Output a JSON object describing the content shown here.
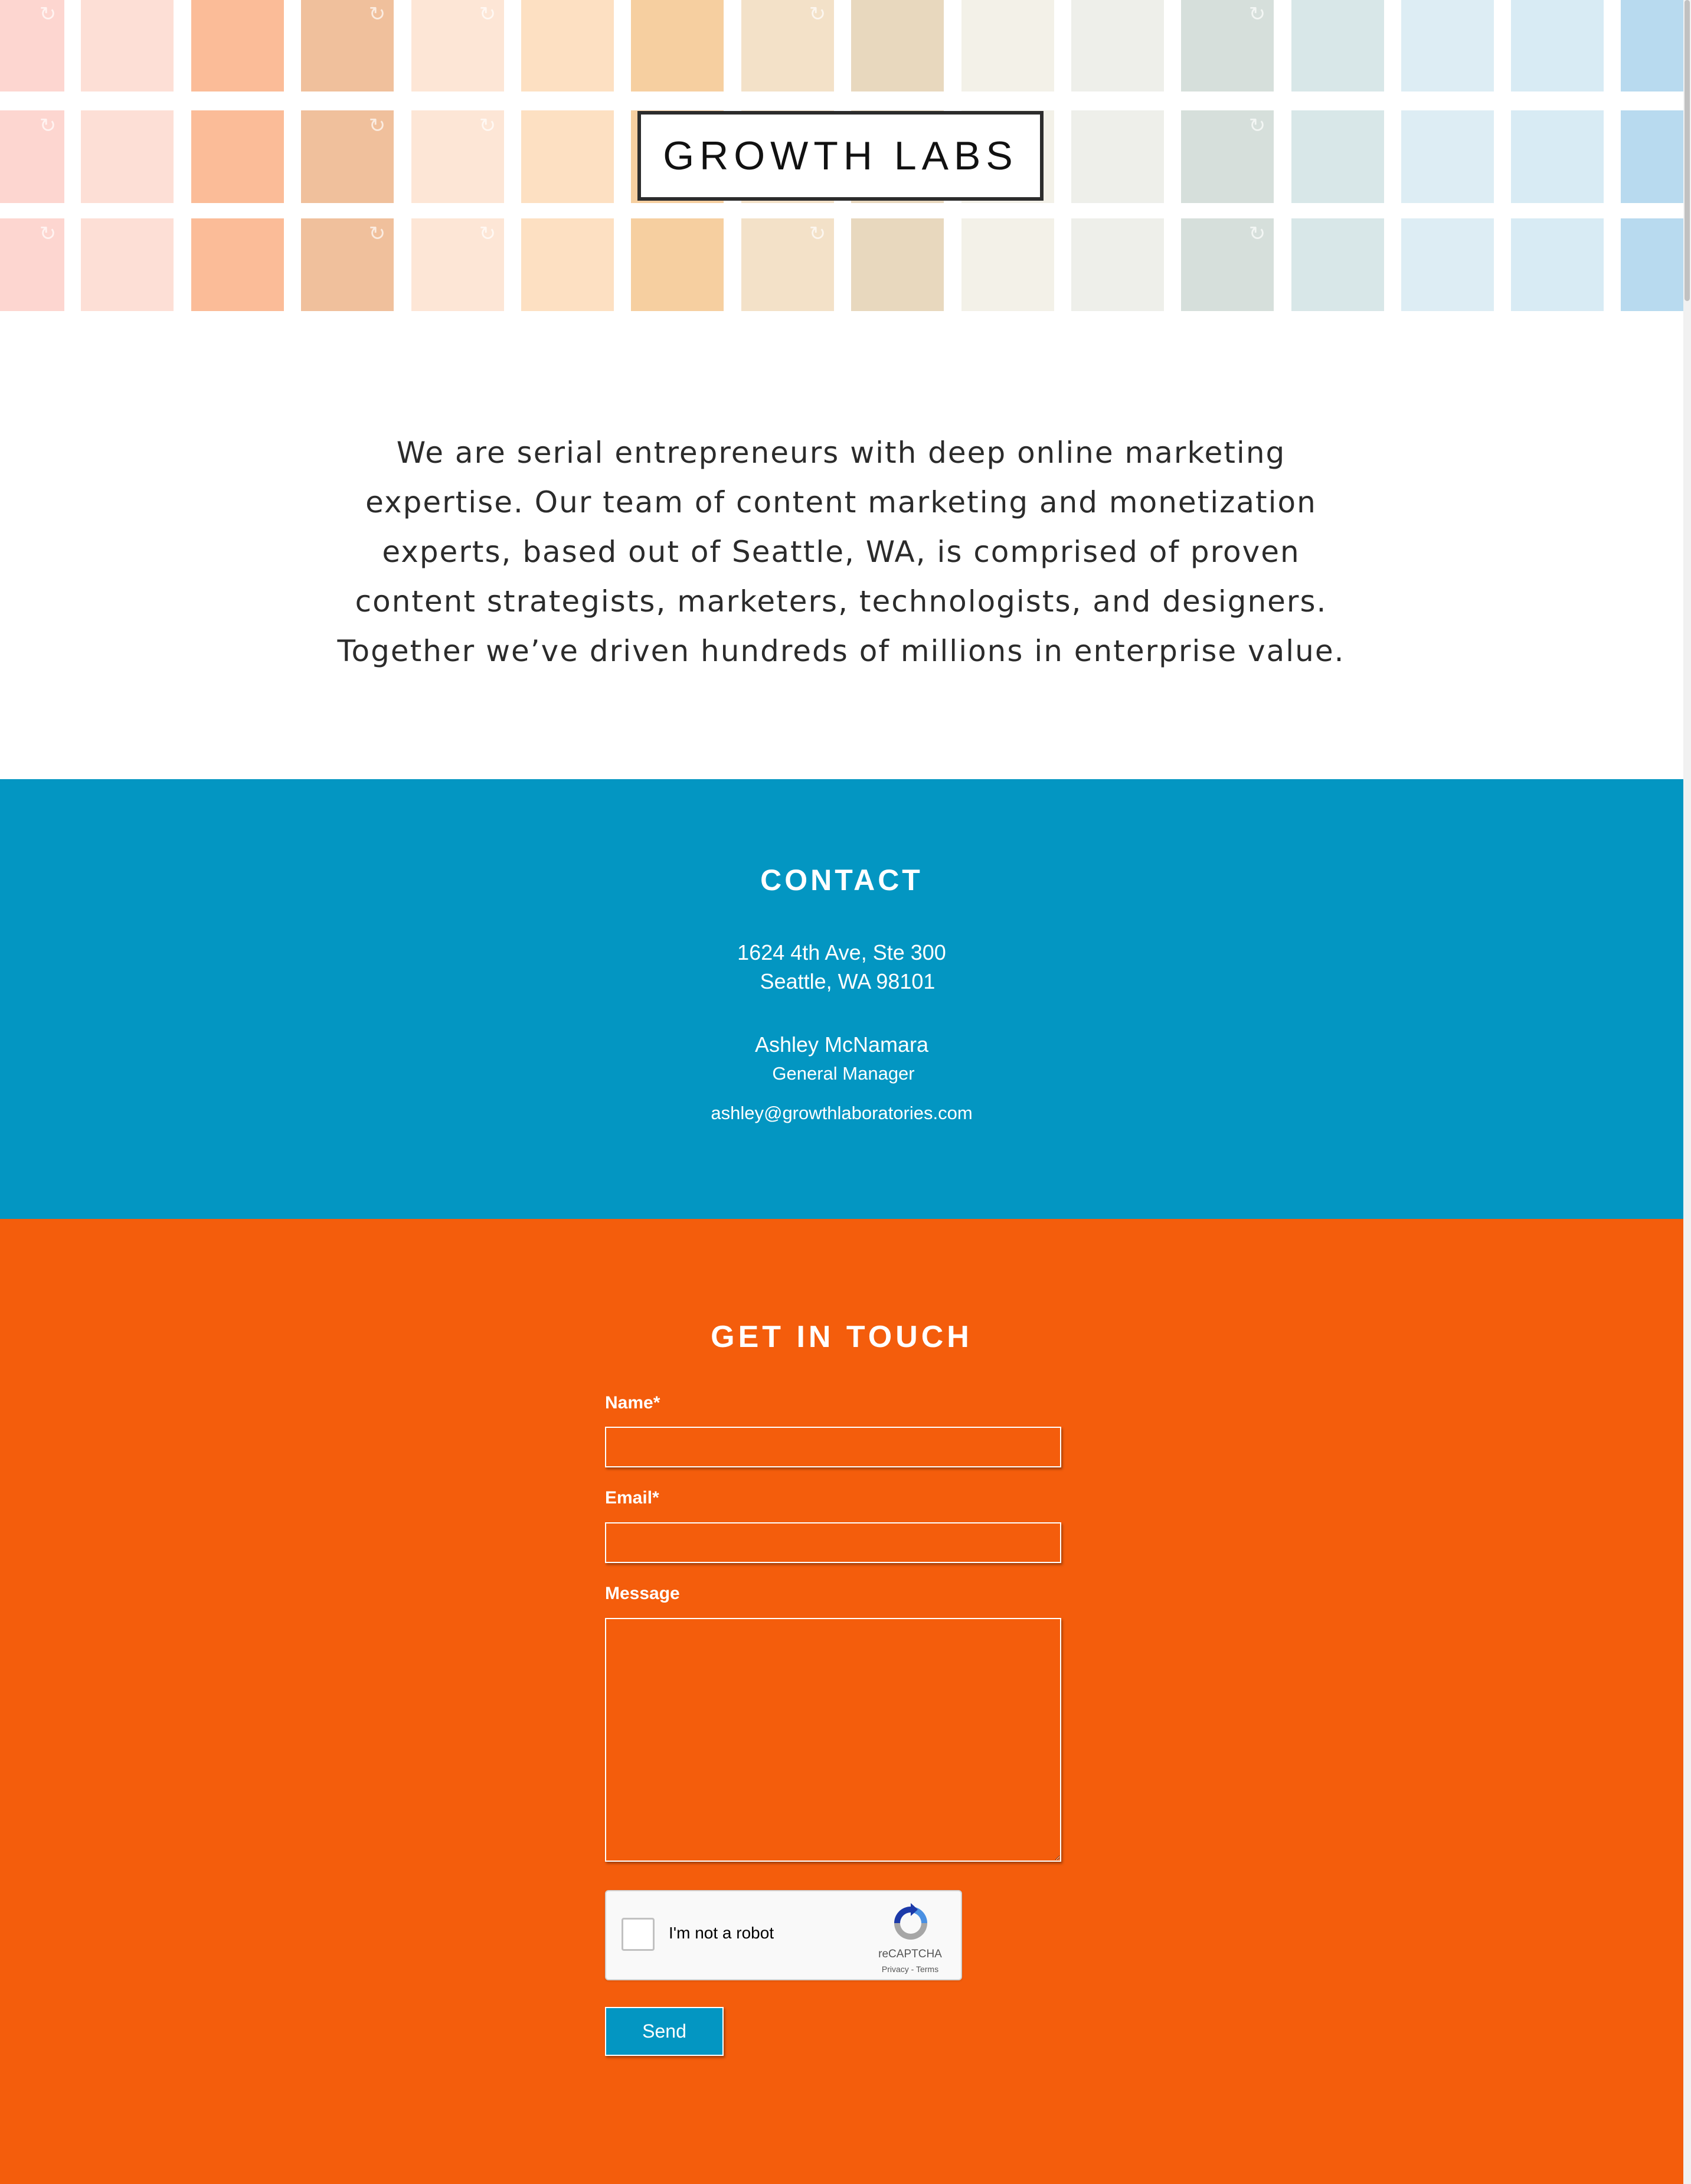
{
  "banner": {
    "logo_text": "GROWTH LABS",
    "tile_colors": [
      "#fdd6d0",
      "#fddfd6",
      "#fbbc98",
      "#f0c09c",
      "#fde6d6",
      "#fde0c2",
      "#f6cfa0",
      "#f3e1c8",
      "#e8d8be",
      "#f3f1e8",
      "#eeefea",
      "#d6dfdb",
      "#d8e7e8",
      "#ddedf4",
      "#d8ebf4",
      "#b8daef"
    ]
  },
  "about": {
    "text": "We are serial entrepreneurs with deep online marketing expertise. Our team of content marketing and monetization experts, based out of Seattle, WA, is comprised of proven content strategists, marketers, technologists, and designers. Together we’ve driven hundreds of millions in enterprise value."
  },
  "contact": {
    "title": "CONTACT",
    "address_line1": "1624 4th Ave, Ste 300",
    "address_line2": "Seattle, WA 98101",
    "person_name": "Ashley McNamara",
    "person_role": "General Manager",
    "email": "ashley@growthlaboratories.com",
    "bg_color": "#0396c2"
  },
  "touch": {
    "title": "GET IN TOUCH",
    "bg_color": "#f45d0c",
    "name_label": "Name*",
    "name_value": "",
    "email_label": "Email*",
    "email_value": "",
    "message_label": "Message",
    "message_value": "",
    "captcha_label": "I'm not a robot",
    "captcha_brand": "reCAPTCHA",
    "captcha_privacy": "Privacy",
    "captcha_separator": " - ",
    "captcha_terms": "Terms",
    "send_label": "Send"
  }
}
